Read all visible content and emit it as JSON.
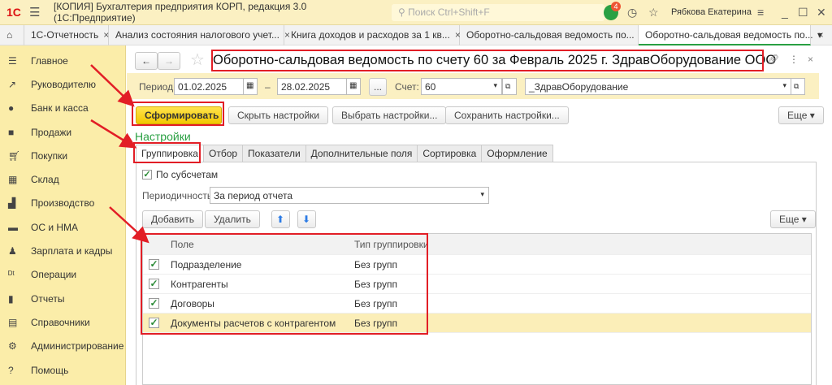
{
  "app": {
    "logo": "1С",
    "title": "[КОПИЯ] Бухгалтерия предприятия КОРП, редакция 3.0  (1С:Предприятие)",
    "search_placeholder": "Поиск Ctrl+Shift+F",
    "notifications": "4",
    "user": "Рябкова Екатерина"
  },
  "tabs": [
    {
      "label": "1С-Отчетность"
    },
    {
      "label": "Анализ состояния налогового учет..."
    },
    {
      "label": "Книга доходов и расходов за 1 кв..."
    },
    {
      "label": "Оборотно-сальдовая ведомость по..."
    },
    {
      "label": "Оборотно-сальдовая ведомость по..."
    }
  ],
  "sidebar": [
    "Главное",
    "Руководителю",
    "Банк и касса",
    "Продажи",
    "Покупки",
    "Склад",
    "Производство",
    "ОС и НМА",
    "Зарплата и кадры",
    "Операции",
    "Отчеты",
    "Справочники",
    "Администрирование",
    "Помощь"
  ],
  "form": {
    "title": "Оборотно-сальдовая ведомость по счету 60 за Февраль 2025 г. ЗдравОборудование ООО",
    "period_label": "Период:",
    "date_from": "01.02.2025",
    "dash": "–",
    "date_to": "28.02.2025",
    "dots": "...",
    "account_label": "Счет:",
    "account": "60",
    "org": "_ЗдравОборудование",
    "generate": "Сформировать",
    "hide_settings": "Скрыть настройки",
    "choose_settings": "Выбрать настройки...",
    "save_settings": "Сохранить настройки...",
    "more": "Еще",
    "settings_title": "Настройки",
    "settings_tabs": [
      "Группировка",
      "Отбор",
      "Показатели",
      "Дополнительные поля",
      "Сортировка",
      "Оформление"
    ],
    "by_subaccounts": "По субсчетам",
    "periodicity_label": "Периодичность:",
    "periodicity": "За период отчета",
    "add": "Добавить",
    "delete": "Удалить",
    "more2": "Еще",
    "columns": [
      "Поле",
      "Тип группировки"
    ],
    "rows": [
      {
        "field": "Подразделение",
        "type": "Без групп"
      },
      {
        "field": "Контрагенты",
        "type": "Без групп"
      },
      {
        "field": "Договоры",
        "type": "Без групп"
      },
      {
        "field": "Документы расчетов с контрагентом",
        "type": "Без групп"
      }
    ]
  }
}
